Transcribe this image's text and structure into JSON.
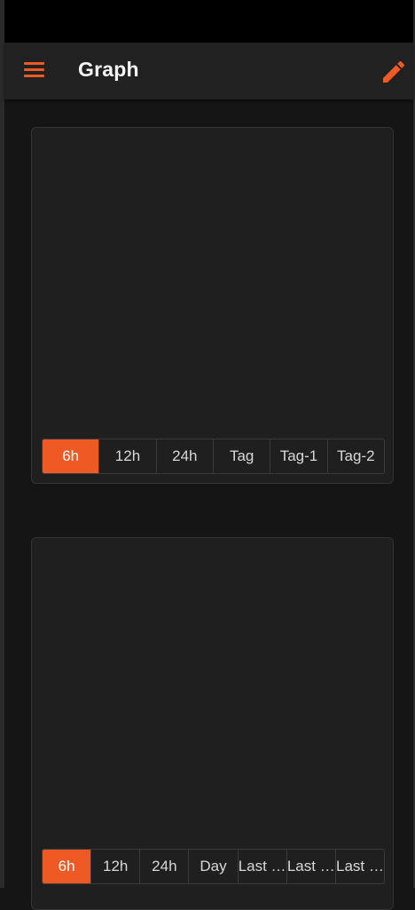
{
  "app_bar": {
    "title": "Graph",
    "menu_icon": "hamburger-menu-icon",
    "edit_icon": "pencil-edit-icon",
    "accent_color": "#ef5a24"
  },
  "graph_cards": [
    {
      "range_options": [
        "6h",
        "12h",
        "24h",
        "Tag",
        "Tag-1",
        "Tag-2"
      ],
      "selected": "6h"
    },
    {
      "range_options": [
        "6h",
        "12h",
        "24h",
        "Day",
        "Last …",
        "Last …",
        "Last …"
      ],
      "selected": "6h"
    }
  ]
}
